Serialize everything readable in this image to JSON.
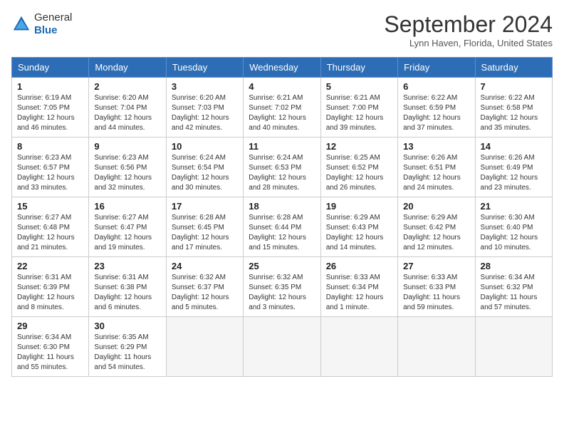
{
  "header": {
    "logo_line1": "General",
    "logo_line2": "Blue",
    "month_title": "September 2024",
    "location": "Lynn Haven, Florida, United States"
  },
  "days_of_week": [
    "Sunday",
    "Monday",
    "Tuesday",
    "Wednesday",
    "Thursday",
    "Friday",
    "Saturday"
  ],
  "weeks": [
    [
      {
        "day": "1",
        "sunrise": "6:19 AM",
        "sunset": "7:05 PM",
        "daylight": "12 hours and 46 minutes."
      },
      {
        "day": "2",
        "sunrise": "6:20 AM",
        "sunset": "7:04 PM",
        "daylight": "12 hours and 44 minutes."
      },
      {
        "day": "3",
        "sunrise": "6:20 AM",
        "sunset": "7:03 PM",
        "daylight": "12 hours and 42 minutes."
      },
      {
        "day": "4",
        "sunrise": "6:21 AM",
        "sunset": "7:02 PM",
        "daylight": "12 hours and 40 minutes."
      },
      {
        "day": "5",
        "sunrise": "6:21 AM",
        "sunset": "7:00 PM",
        "daylight": "12 hours and 39 minutes."
      },
      {
        "day": "6",
        "sunrise": "6:22 AM",
        "sunset": "6:59 PM",
        "daylight": "12 hours and 37 minutes."
      },
      {
        "day": "7",
        "sunrise": "6:22 AM",
        "sunset": "6:58 PM",
        "daylight": "12 hours and 35 minutes."
      }
    ],
    [
      {
        "day": "8",
        "sunrise": "6:23 AM",
        "sunset": "6:57 PM",
        "daylight": "12 hours and 33 minutes."
      },
      {
        "day": "9",
        "sunrise": "6:23 AM",
        "sunset": "6:56 PM",
        "daylight": "12 hours and 32 minutes."
      },
      {
        "day": "10",
        "sunrise": "6:24 AM",
        "sunset": "6:54 PM",
        "daylight": "12 hours and 30 minutes."
      },
      {
        "day": "11",
        "sunrise": "6:24 AM",
        "sunset": "6:53 PM",
        "daylight": "12 hours and 28 minutes."
      },
      {
        "day": "12",
        "sunrise": "6:25 AM",
        "sunset": "6:52 PM",
        "daylight": "12 hours and 26 minutes."
      },
      {
        "day": "13",
        "sunrise": "6:26 AM",
        "sunset": "6:51 PM",
        "daylight": "12 hours and 24 minutes."
      },
      {
        "day": "14",
        "sunrise": "6:26 AM",
        "sunset": "6:49 PM",
        "daylight": "12 hours and 23 minutes."
      }
    ],
    [
      {
        "day": "15",
        "sunrise": "6:27 AM",
        "sunset": "6:48 PM",
        "daylight": "12 hours and 21 minutes."
      },
      {
        "day": "16",
        "sunrise": "6:27 AM",
        "sunset": "6:47 PM",
        "daylight": "12 hours and 19 minutes."
      },
      {
        "day": "17",
        "sunrise": "6:28 AM",
        "sunset": "6:45 PM",
        "daylight": "12 hours and 17 minutes."
      },
      {
        "day": "18",
        "sunrise": "6:28 AM",
        "sunset": "6:44 PM",
        "daylight": "12 hours and 15 minutes."
      },
      {
        "day": "19",
        "sunrise": "6:29 AM",
        "sunset": "6:43 PM",
        "daylight": "12 hours and 14 minutes."
      },
      {
        "day": "20",
        "sunrise": "6:29 AM",
        "sunset": "6:42 PM",
        "daylight": "12 hours and 12 minutes."
      },
      {
        "day": "21",
        "sunrise": "6:30 AM",
        "sunset": "6:40 PM",
        "daylight": "12 hours and 10 minutes."
      }
    ],
    [
      {
        "day": "22",
        "sunrise": "6:31 AM",
        "sunset": "6:39 PM",
        "daylight": "12 hours and 8 minutes."
      },
      {
        "day": "23",
        "sunrise": "6:31 AM",
        "sunset": "6:38 PM",
        "daylight": "12 hours and 6 minutes."
      },
      {
        "day": "24",
        "sunrise": "6:32 AM",
        "sunset": "6:37 PM",
        "daylight": "12 hours and 5 minutes."
      },
      {
        "day": "25",
        "sunrise": "6:32 AM",
        "sunset": "6:35 PM",
        "daylight": "12 hours and 3 minutes."
      },
      {
        "day": "26",
        "sunrise": "6:33 AM",
        "sunset": "6:34 PM",
        "daylight": "12 hours and 1 minute."
      },
      {
        "day": "27",
        "sunrise": "6:33 AM",
        "sunset": "6:33 PM",
        "daylight": "11 hours and 59 minutes."
      },
      {
        "day": "28",
        "sunrise": "6:34 AM",
        "sunset": "6:32 PM",
        "daylight": "11 hours and 57 minutes."
      }
    ],
    [
      {
        "day": "29",
        "sunrise": "6:34 AM",
        "sunset": "6:30 PM",
        "daylight": "11 hours and 55 minutes."
      },
      {
        "day": "30",
        "sunrise": "6:35 AM",
        "sunset": "6:29 PM",
        "daylight": "11 hours and 54 minutes."
      },
      null,
      null,
      null,
      null,
      null
    ]
  ]
}
